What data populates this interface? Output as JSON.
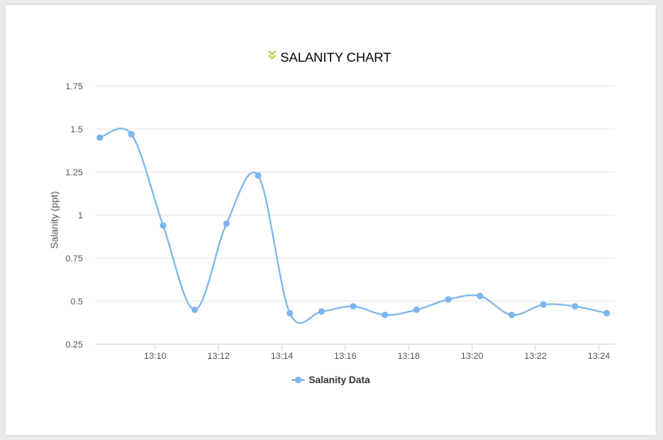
{
  "chart_data": {
    "type": "line",
    "title": "SALANITY CHART",
    "ylabel": "Salanity (ppt)",
    "xlabel": "",
    "ylim": [
      0.25,
      1.75
    ],
    "y_ticks": [
      "0.25",
      "0.5",
      "0.75",
      "1",
      "1.25",
      "1.5",
      "1.75"
    ],
    "x_ticks": [
      "13:10",
      "13:12",
      "13:14",
      "13:16",
      "13:18",
      "13:20",
      "13:22",
      "13:24"
    ],
    "x": [
      "13:08:15",
      "13:09:15",
      "13:10:15",
      "13:11:15",
      "13:12:15",
      "13:13:15",
      "13:14:15",
      "13:15:15",
      "13:16:15",
      "13:17:15",
      "13:18:15",
      "13:19:15",
      "13:20:15",
      "13:21:15",
      "13:22:15",
      "13:23:15",
      "13:24:15"
    ],
    "series": [
      {
        "name": "Salanity Data",
        "color": "#7cb5ec",
        "values": [
          1.45,
          1.47,
          0.94,
          0.45,
          0.95,
          1.23,
          0.43,
          0.44,
          0.47,
          0.42,
          0.45,
          0.51,
          0.53,
          0.42,
          0.48,
          0.47,
          0.43
        ]
      }
    ],
    "grid": true,
    "legend": "bottom-center",
    "title_icon": "double-chevron-down-icon",
    "title_icon_color": "#a8d93a"
  }
}
